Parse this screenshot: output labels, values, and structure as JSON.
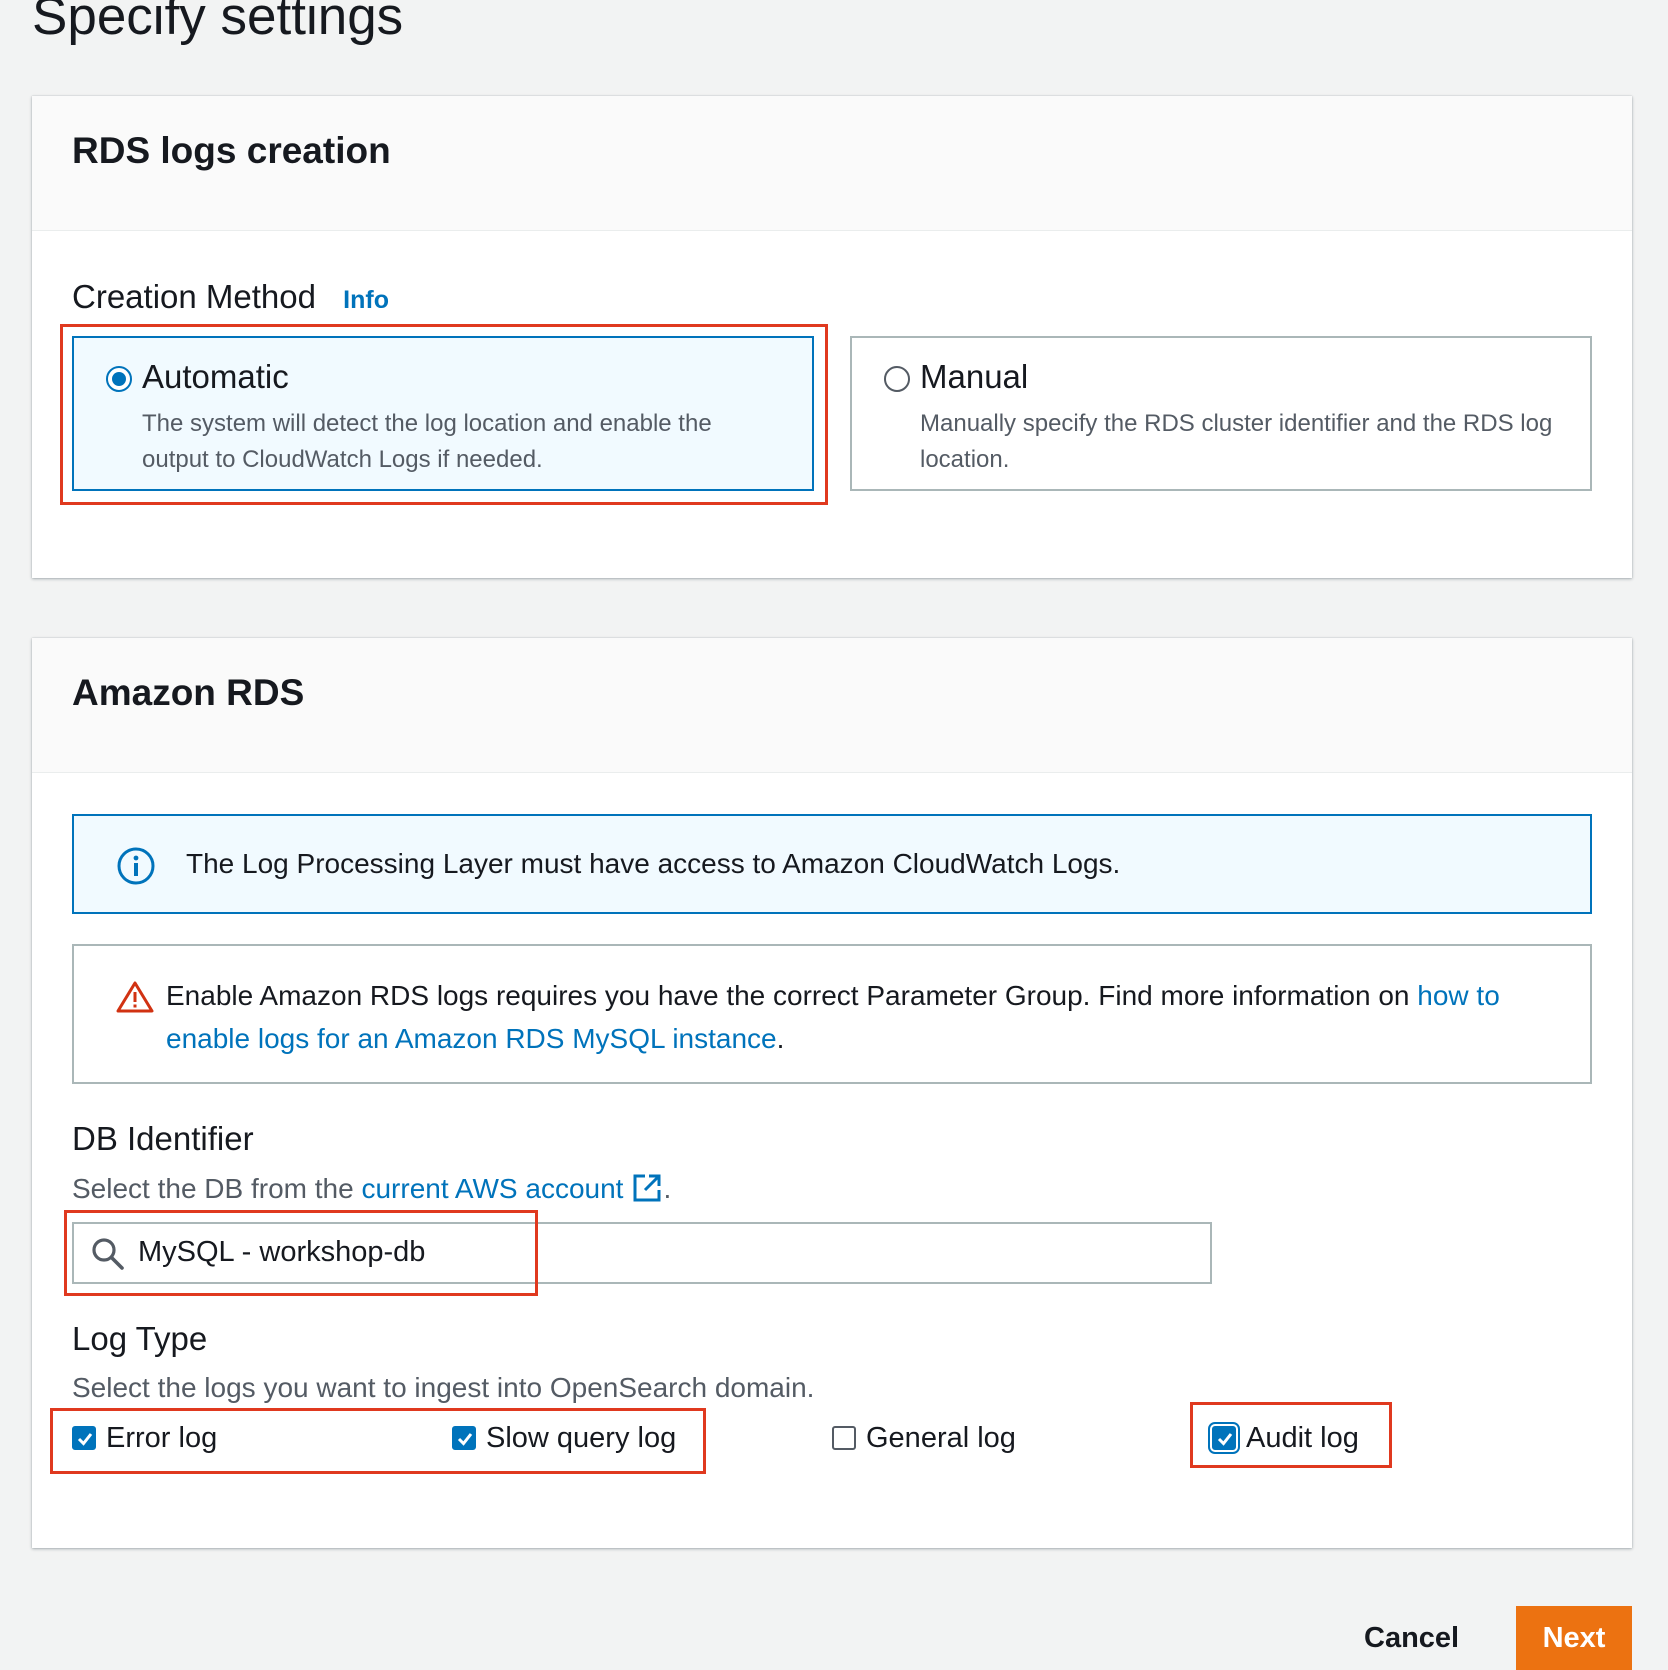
{
  "page": {
    "title": "Specify settings"
  },
  "rds_logs_creation": {
    "header": "RDS logs creation",
    "creation_method_label": "Creation Method",
    "info_link": "Info",
    "options": [
      {
        "label": "Automatic",
        "description": "The system will detect the log location and enable the output to CloudWatch Logs if needed.",
        "selected": true
      },
      {
        "label": "Manual",
        "description": "Manually specify the RDS cluster identifier and the RDS log location.",
        "selected": false
      }
    ]
  },
  "amazon_rds": {
    "header": "Amazon RDS",
    "info_alert": "The Log Processing Layer must have access to Amazon CloudWatch Logs.",
    "warning_alert": {
      "text": "Enable Amazon RDS logs requires you have the correct Parameter Group. Find more information on ",
      "link": "how to enable logs for an Amazon RDS MySQL instance",
      "suffix": "."
    },
    "db_identifier": {
      "label": "DB Identifier",
      "description_prefix": "Select the DB from the ",
      "description_link": "current AWS account",
      "description_suffix": ".",
      "value": "MySQL - workshop-db"
    },
    "log_type": {
      "label": "Log Type",
      "description": "Select the logs you want to ingest into OpenSearch domain.",
      "options": [
        {
          "label": "Error log",
          "checked": true
        },
        {
          "label": "Slow query log",
          "checked": true
        },
        {
          "label": "General log",
          "checked": false
        },
        {
          "label": "Audit log",
          "checked": true
        }
      ]
    }
  },
  "footer": {
    "cancel_label": "Cancel",
    "next_label": "Next"
  },
  "colors": {
    "link": "#0073bb",
    "primary_button": "#ec7211",
    "highlight": "#e0391f"
  }
}
